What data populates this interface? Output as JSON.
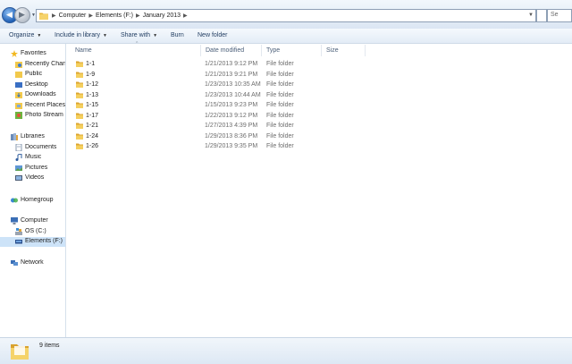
{
  "address_bar": {
    "breadcrumbs": [
      "Computer",
      "Elements (F:)",
      "January 2013"
    ],
    "search_placeholder": "Se"
  },
  "toolbar": {
    "organize": "Organize",
    "include_in_library": "Include in library",
    "share_with": "Share with",
    "burn": "Burn",
    "new_folder": "New folder"
  },
  "nav": {
    "favorites": "Favorites",
    "recently_changed": "Recently Chang",
    "public": "Public",
    "desktop": "Desktop",
    "downloads": "Downloads",
    "recent_places": "Recent Places",
    "photo_stream": "Photo Stream",
    "libraries": "Libraries",
    "documents": "Documents",
    "music": "Music",
    "pictures": "Pictures",
    "videos": "Videos",
    "homegroup": "Homegroup",
    "computer": "Computer",
    "os_c": "OS (C:)",
    "elements_f": "Elements (F:)",
    "network": "Network"
  },
  "columns": {
    "name": "Name",
    "date_modified": "Date modified",
    "type": "Type",
    "size": "Size"
  },
  "files": [
    {
      "name": "1-1",
      "date": "1/21/2013 9:12 PM",
      "type": "File folder"
    },
    {
      "name": "1-9",
      "date": "1/21/2013 9:21 PM",
      "type": "File folder"
    },
    {
      "name": "1-12",
      "date": "1/23/2013 10:35 AM",
      "type": "File folder"
    },
    {
      "name": "1-13",
      "date": "1/23/2013 10:44 AM",
      "type": "File folder"
    },
    {
      "name": "1-15",
      "date": "1/15/2013 9:23 PM",
      "type": "File folder"
    },
    {
      "name": "1-17",
      "date": "1/22/2013 9:12 PM",
      "type": "File folder"
    },
    {
      "name": "1-21",
      "date": "1/27/2013 4:39 PM",
      "type": "File folder"
    },
    {
      "name": "1-24",
      "date": "1/29/2013 8:36 PM",
      "type": "File folder"
    },
    {
      "name": "1-26",
      "date": "1/29/2013 9:35 PM",
      "type": "File folder"
    }
  ],
  "status": {
    "item_count": "9 items"
  },
  "colors": {
    "selection": "#cde3f8",
    "folder": "#f2c94c",
    "accent": "#1f5fb5"
  }
}
